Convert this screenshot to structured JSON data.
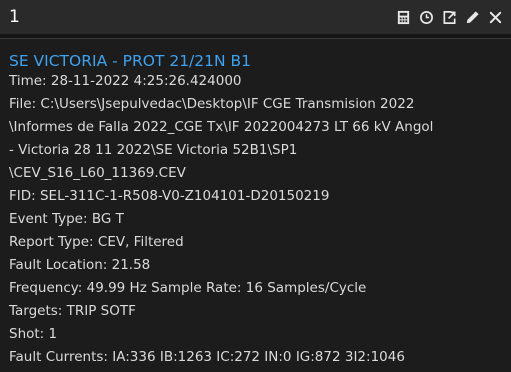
{
  "window": {
    "title": "1"
  },
  "toolbar": {
    "icons": [
      "calculator-icon",
      "clock-icon",
      "export-icon",
      "pencil-icon",
      "close-icon"
    ]
  },
  "record": {
    "heading": "SE VICTORIA - PROT 21/21N B1",
    "lines": [
      "Time:  28-11-2022 4:25:26.424000",
      "File: C:\\Users\\Jsepulvedac\\Desktop\\IF CGE Transmision 2022",
      "\\Informes de Falla 2022_CGE Tx\\IF 2022004273 LT 66 kV Angol",
      "- Victoria   28 11 2022\\SE Victoria 52B1\\SP1",
      "\\CEV_S16_L60_11369.CEV",
      "FID: SEL-311C-1-R508-V0-Z104101-D20150219",
      "Event Type: BG T",
      "Report Type: CEV, Filtered",
      "Fault Location: 21.58",
      "Frequency: 49.99 Hz   Sample Rate: 16 Samples/Cycle",
      "Targets: TRIP SOTF",
      "Shot: 1",
      "Fault Currents: IA:336 IB:1263 IC:272 IN:0 IG:872 3I2:1046"
    ]
  },
  "colors": {
    "heading": "#3ea2ef",
    "text": "#dadada",
    "background": "#1c1c1c",
    "titlebar": "#2a2a2a"
  }
}
